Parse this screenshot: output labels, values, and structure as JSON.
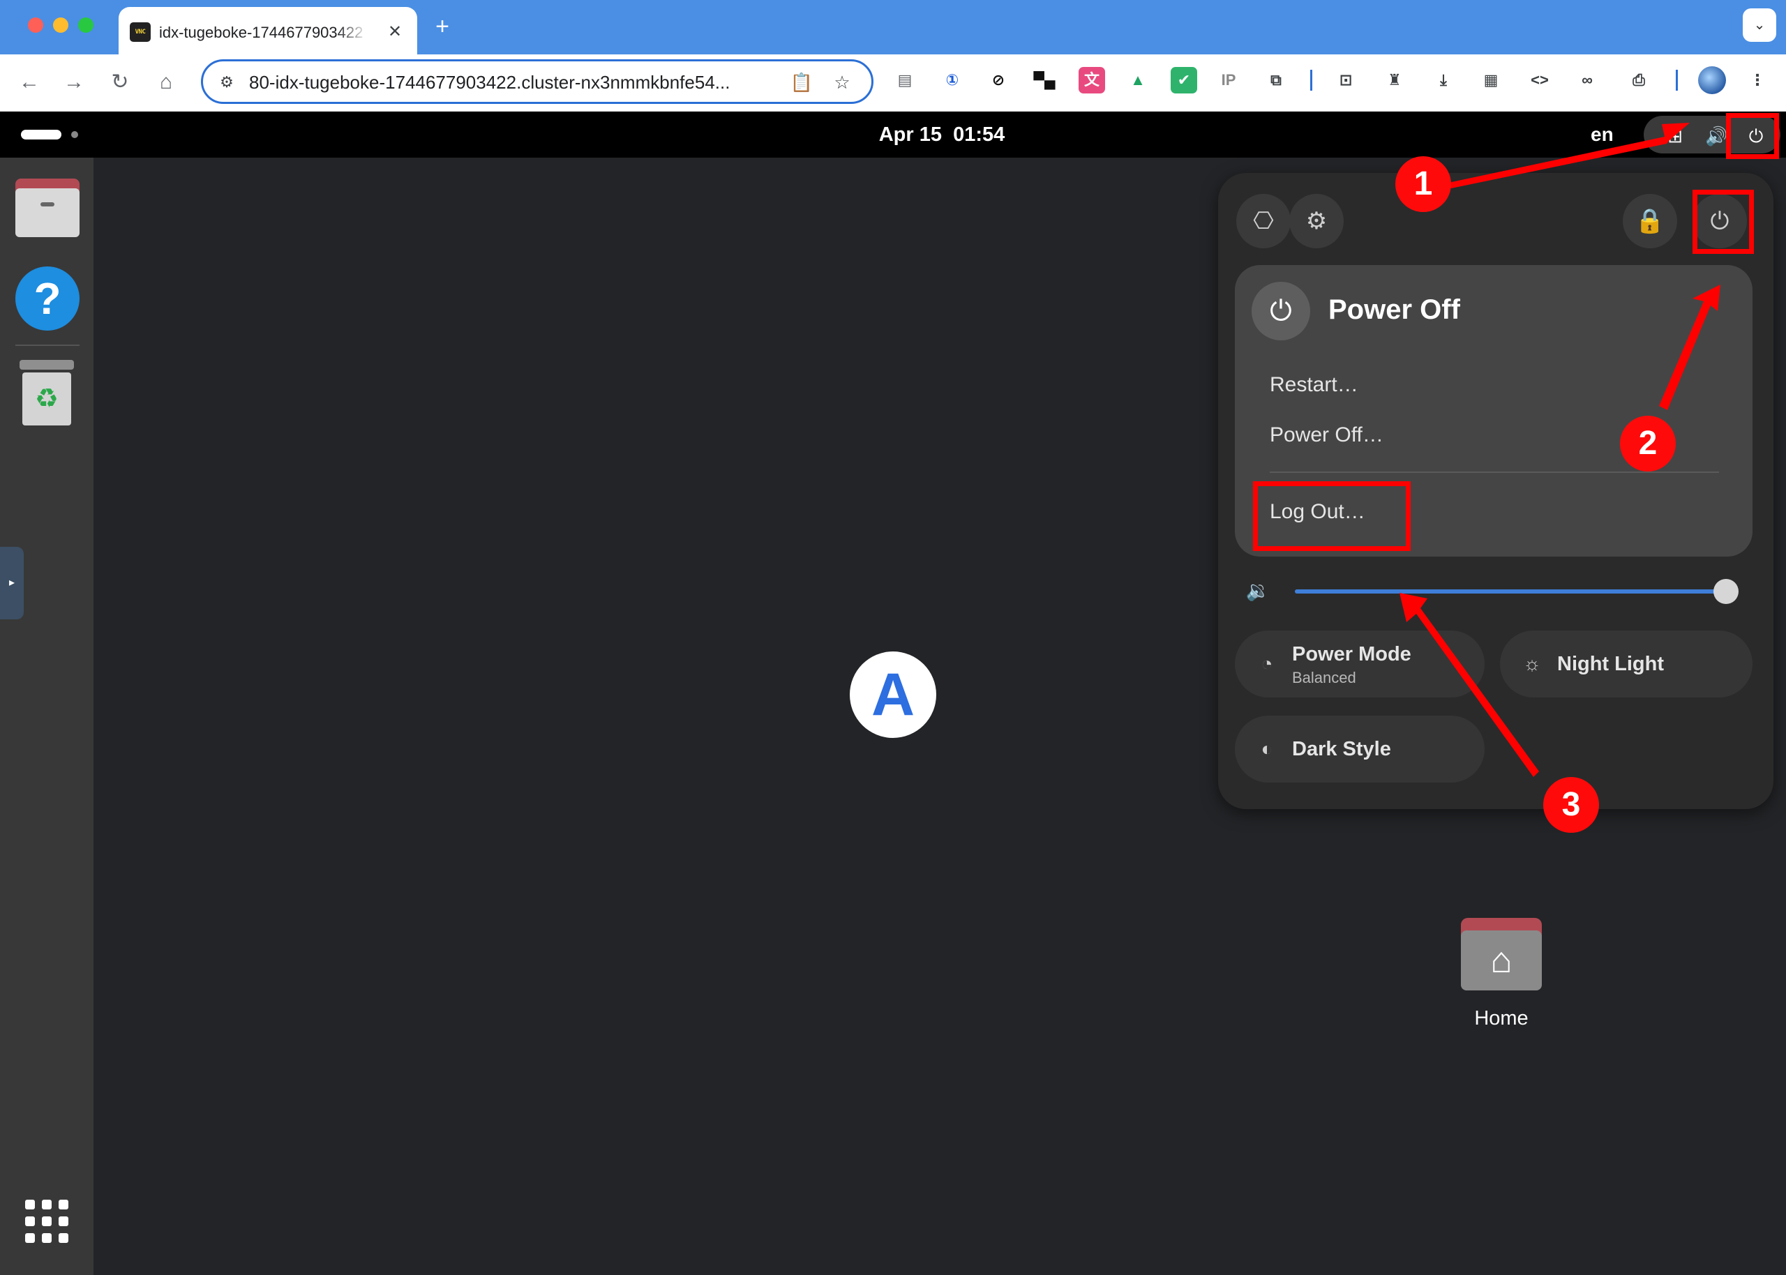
{
  "browser": {
    "tab": {
      "title": "idx-tugeboke-1744677903422",
      "favicon_text": "VNC",
      "close_glyph": "✕"
    },
    "new_tab_glyph": "+",
    "tab_search_glyph": "⌄",
    "nav": {
      "back": "←",
      "forward": "→",
      "reload": "↻",
      "home": "⌂"
    },
    "address_bar": {
      "url": "80-idx-tugeboke-1744677903422.cluster-nx3nmmkbnfe54...",
      "site_info_glyph": "⚙",
      "clipboard_glyph": "📋",
      "star_glyph": "☆"
    },
    "extensions": [
      {
        "name": "reader-icon",
        "glyph": "▤",
        "color": "#5f6368",
        "bg": "transparent"
      },
      {
        "name": "password-manager-icon",
        "glyph": "①",
        "color": "#1a5bd8",
        "bg": "transparent"
      },
      {
        "name": "block-icon",
        "glyph": "⊘",
        "color": "#111111",
        "bg": "transparent"
      },
      {
        "name": "tampermonkey-icon",
        "glyph": "▀▄",
        "color": "#111111",
        "bg": "transparent"
      },
      {
        "name": "translate-icon",
        "glyph": "文",
        "color": "#ffffff",
        "bg": "#e84a7f"
      },
      {
        "name": "drive-icon",
        "glyph": "▲",
        "color": "#1ea362",
        "bg": "transparent"
      },
      {
        "name": "shield-icon",
        "glyph": "✔",
        "color": "#ffffff",
        "bg": "#2fb36c"
      },
      {
        "name": "ip-icon",
        "glyph": "IP",
        "color": "#888888",
        "bg": "transparent"
      },
      {
        "name": "puzzle-icon",
        "glyph": "⧉",
        "color": "#3c4043",
        "bg": "transparent"
      },
      {
        "name": "screenshot-icon",
        "glyph": "⊡",
        "color": "#3c4043",
        "bg": "transparent"
      },
      {
        "name": "incognito-icon",
        "glyph": "♜",
        "color": "#3c4043",
        "bg": "transparent"
      },
      {
        "name": "download-icon",
        "glyph": "⤓",
        "color": "#3c4043",
        "bg": "transparent"
      },
      {
        "name": "qr-code-icon",
        "glyph": "▦",
        "color": "#3c4043",
        "bg": "transparent"
      },
      {
        "name": "code-icon",
        "glyph": "<>",
        "color": "#3c4043",
        "bg": "transparent"
      },
      {
        "name": "link-icon",
        "glyph": "∞",
        "color": "#3c4043",
        "bg": "transparent"
      },
      {
        "name": "print-icon",
        "glyph": "⎙",
        "color": "#3c4043",
        "bg": "transparent"
      },
      {
        "name": "menu-icon",
        "glyph": "⋮",
        "color": "#3c4043",
        "bg": "transparent"
      }
    ]
  },
  "desktop": {
    "topbar": {
      "clock": "Apr 15  01:54",
      "language": "en",
      "network_glyph": "⊞",
      "volume_glyph": "🔊",
      "power_glyph": "⏻"
    },
    "dock": {
      "help_glyph": "?",
      "trash_glyph": "♻",
      "handle_glyph": "▸"
    },
    "app_icon_glyph": "A",
    "home": {
      "label": "Home",
      "glyph": "⌂"
    }
  },
  "quick_settings": {
    "screenshot_glyph": "⎔",
    "settings_glyph": "⚙",
    "lock_glyph": "🔒",
    "power_glyph": "⏻",
    "power_menu": {
      "icon_glyph": "⏻",
      "title": "Power Off",
      "items": [
        "Restart…",
        "Power Off…",
        "Log Out…"
      ]
    },
    "volume": {
      "glyph": "🔉",
      "level": 1.0
    },
    "tiles": {
      "power_mode": {
        "title": "Power Mode",
        "subtitle": "Balanced",
        "glyph": "◔"
      },
      "night_light": {
        "title": "Night Light",
        "glyph": "☼"
      },
      "dark_style": {
        "title": "Dark Style",
        "glyph": "◐"
      }
    }
  },
  "annotations": {
    "steps": [
      "1",
      "2",
      "3"
    ],
    "color": "#ff0000"
  }
}
